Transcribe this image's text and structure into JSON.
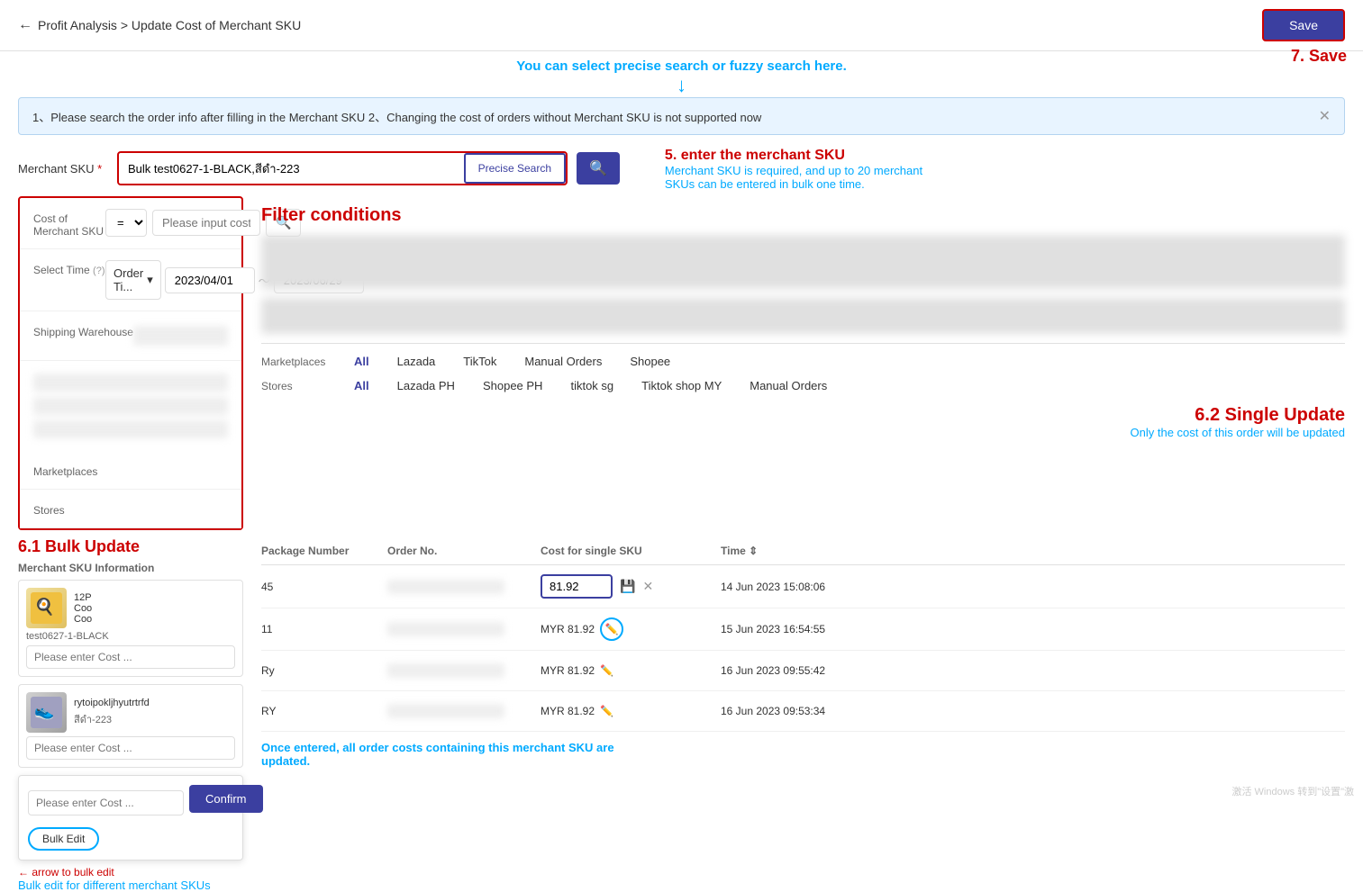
{
  "header": {
    "back_label": "←",
    "breadcrumb": "Profit Analysis > Update Cost of Merchant SKU",
    "save_label": "Save",
    "save_annotation": "7. Save"
  },
  "annotations": {
    "top_hint": "You can select precise search or fuzzy search here.",
    "anno5_title": "5. enter the merchant SKU",
    "anno5_sub": "Merchant SKU is required, and up to 20 merchant SKUs can be entered in bulk one time.",
    "anno62_title": "6.2 Single Update",
    "anno62_sub": "Only the cost of this order will be updated",
    "anno61_title": "6.1 Bulk Update",
    "bulk_hint": "Bulk edit for different merchant SKUs",
    "once_entered": "Once entered, all order costs containing this merchant SKU are updated."
  },
  "info_bar": {
    "text": "1、Please search the order info after filling in the Merchant SKU   2、Changing the cost of orders without Merchant SKU is not supported now"
  },
  "filter": {
    "merchant_sku_label": "Merchant SKU",
    "req_marker": "*",
    "sku_value": "Bulk test0627-1-BLACK,สีดำ-223",
    "precise_search_label": "Precise Search",
    "cost_label": "Cost of Merchant SKU",
    "eq_operator": "=",
    "cost_placeholder": "Please input cost of merchant SKU",
    "time_label": "Select Time",
    "time_type": "Order Ti...",
    "date_from": "2023/04/01",
    "date_to": "2023/06/29",
    "shipping_label": "Shipping Warehouse",
    "filter_cond_label": "Filter conditions",
    "marketplaces_label": "Marketplaces",
    "marketplace_tabs": [
      "All",
      "Lazada",
      "TikTok",
      "Manual Orders",
      "Shopee"
    ],
    "stores_label": "Stores",
    "store_tabs": [
      "All",
      "Lazada PH",
      "Shopee PH",
      "tiktok sg",
      "Tiktok shop MY",
      "Manual Orders"
    ]
  },
  "bulk_popup": {
    "confirm_label": "Confirm",
    "bulk_edit_label": "Bulk Edit",
    "cost_placeholder": "Please enter Cost ...",
    "cost_placeholder2": "Please enter Cost ..."
  },
  "table": {
    "col_merchant_sku": "Merchant SKU Information",
    "col_package": "Package Number",
    "col_order": "Order No.",
    "col_cost_single": "Cost for single SKU",
    "col_time": "Time ⇕",
    "rows": [
      {
        "sku_name": "12P Coo Coo",
        "sku_id": "test0627-1-BLACK",
        "pkg": "45",
        "order": "",
        "cost": "81.92",
        "cost_display": "81.92",
        "time": "14 Jun 2023 15:08:06",
        "editing": true
      },
      {
        "sku_name": "",
        "sku_id": "",
        "pkg": "11",
        "order": "",
        "cost_display": "MYR 81.92",
        "time": "15 Jun 2023 16:54:55",
        "editing": false
      },
      {
        "sku_name": "rytoipokljhyutrtrfd",
        "sku_id": "สีดำ-223",
        "pkg": "Ry",
        "order": "",
        "cost_display": "MYR 81.92",
        "time": "16 Jun 2023 09:55:42",
        "editing": false
      },
      {
        "sku_name": "",
        "sku_id": "",
        "pkg": "RY",
        "order": "",
        "cost_display": "MYR 81.92",
        "time": "16 Jun 2023 09:53:34",
        "editing": false
      }
    ]
  },
  "watermark": "激活 Windows 转到\"设置\"激"
}
